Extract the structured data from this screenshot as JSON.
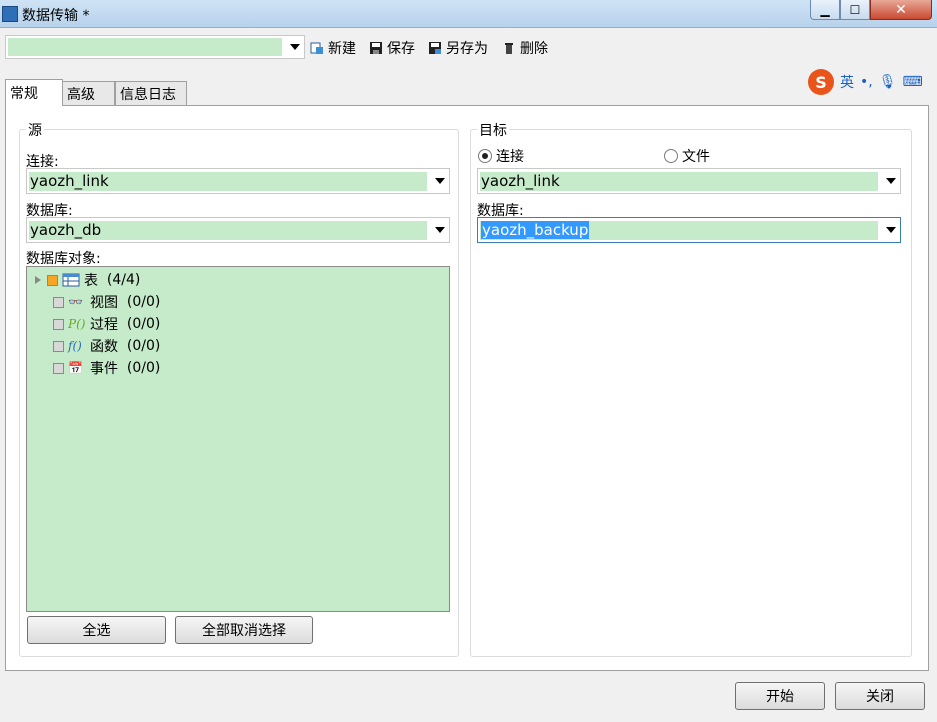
{
  "window": {
    "title": "数据传输 *"
  },
  "toolbar": {
    "profile_value": "",
    "new_label": "新建",
    "save_label": "保存",
    "save_as_label": "另存为",
    "delete_label": "删除"
  },
  "ime": {
    "mode": "英"
  },
  "tabs": [
    {
      "label": "常规"
    },
    {
      "label": "高级"
    },
    {
      "label": "信息日志"
    }
  ],
  "source": {
    "group_label": "源",
    "connection_label": "连接:",
    "connection_value": "yaozh_link",
    "database_label": "数据库:",
    "database_value": "yaozh_db",
    "objects_label": "数据库对象:",
    "tree": [
      {
        "label": "表",
        "count": "(4/4)"
      },
      {
        "label": "视图",
        "count": "(0/0)"
      },
      {
        "label": "过程",
        "count": "(0/0)"
      },
      {
        "label": "函数",
        "count": "(0/0)"
      },
      {
        "label": "事件",
        "count": "(0/0)"
      }
    ],
    "select_all_label": "全选",
    "deselect_all_label": "全部取消选择"
  },
  "target": {
    "group_label": "目标",
    "radio_connection_label": "连接",
    "radio_file_label": "文件",
    "connection_value": "yaozh_link",
    "database_label": "数据库:",
    "database_value": "yaozh_backup"
  },
  "footer": {
    "start_label": "开始",
    "close_label": "关闭"
  }
}
